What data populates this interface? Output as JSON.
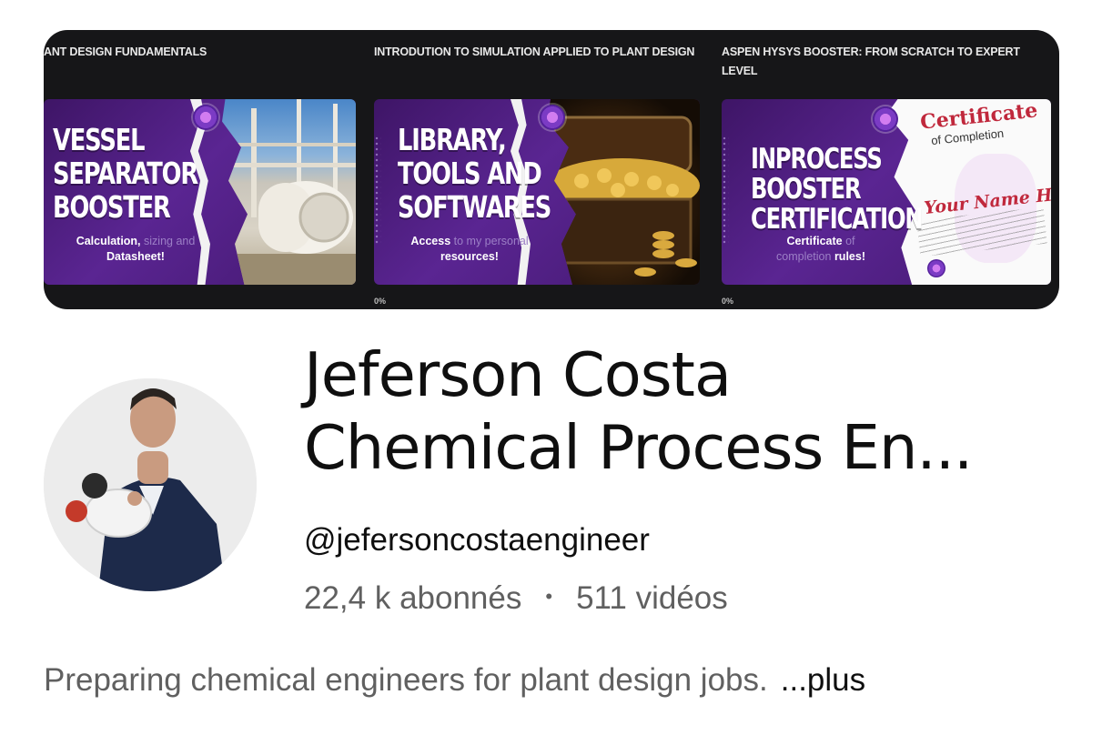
{
  "banner": {
    "cards": [
      {
        "title": "ANT DESIGN FUNDAMENTALS",
        "thumb_heading": [
          "VESSEL",
          "SEPARATOR",
          "BOOSTER"
        ],
        "thumb_sub_bright": "Calculation,",
        "thumb_sub_dim": "sizing and",
        "thumb_sub_line2": "Datasheet!",
        "progress": ""
      },
      {
        "title": "INTRODUTION TO SIMULATION APPLIED TO PLANT DESIGN",
        "thumb_heading": [
          "LIBRARY,",
          "TOOLS AND",
          "SOFTWARES"
        ],
        "thumb_sub_bright": "Access",
        "thumb_sub_dim": "to my personal",
        "thumb_sub_line2": "resources!",
        "progress": "0%"
      },
      {
        "title": "ASPEN HYSYS BOOSTER: FROM SCRATCH TO EXPERT LEVEL",
        "thumb_heading": [
          "INPROCESS",
          "BOOSTER",
          "CERTIFICATION"
        ],
        "thumb_sub_bright": "Certificate",
        "thumb_sub_dim": "of",
        "thumb_sub_line2_dim": "completion",
        "thumb_sub_line2": "rules!",
        "cert_title": "Certificate",
        "cert_subtitle": "of Completion",
        "cert_name": "Your Name Here",
        "progress": "0%"
      }
    ]
  },
  "channel": {
    "name_line1": "Jeferson Costa",
    "name_line2": "Chemical Process En...",
    "handle": "@jefersoncostaengineer",
    "subscribers": "22,4 k abonnés",
    "separator": "•",
    "videos": "511 vidéos",
    "description": "Preparing chemical engineers for plant design jobs.",
    "more_label": "...plus"
  }
}
